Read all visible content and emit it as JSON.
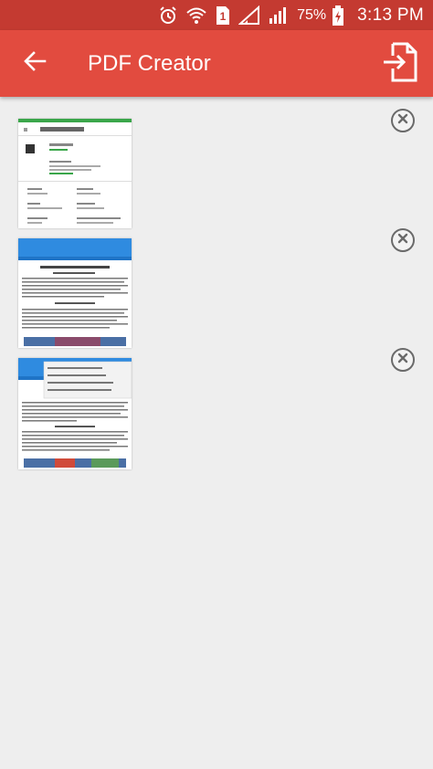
{
  "status_bar": {
    "battery_percent": "75%",
    "time": "3:13 PM",
    "sim_slot": "1",
    "icons": [
      "alarm-icon",
      "wifi-icon",
      "sim-icon",
      "signal-icon",
      "signal-icon",
      "battery-charging-icon"
    ]
  },
  "toolbar": {
    "title": "PDF Creator",
    "back_icon": "arrow-back-icon",
    "export_icon": "export-file-icon"
  },
  "pages": [
    {
      "name": "page-1",
      "remove_icon": "close-icon"
    },
    {
      "name": "page-2",
      "remove_icon": "close-icon"
    },
    {
      "name": "page-3",
      "remove_icon": "close-icon"
    }
  ],
  "colors": {
    "status_bar": "#c43a31",
    "toolbar": "#e24b3f",
    "background": "#eeeeee",
    "thumb_blue": "#2f8be0",
    "remove_icon": "#6a6a6a"
  }
}
